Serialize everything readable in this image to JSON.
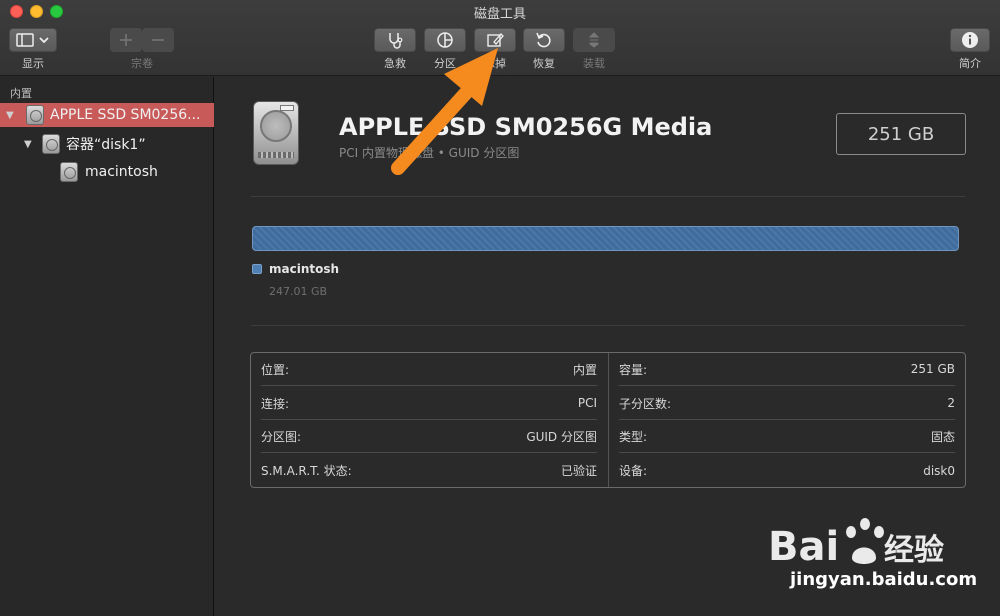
{
  "window": {
    "title": "磁盘工具"
  },
  "toolbar": {
    "view_label": "显示",
    "volume_label": "宗卷",
    "first_aid_label": "急救",
    "partition_label": "分区",
    "erase_label": "抹掉",
    "restore_label": "恢复",
    "mount_label": "装载",
    "info_label": "简介"
  },
  "sidebar": {
    "section": "内置",
    "items": [
      {
        "label": "APPLE SSD SM0256...",
        "selected": true
      },
      {
        "label": "容器“disk1”",
        "selected": false
      },
      {
        "label": "macintosh",
        "selected": false
      }
    ]
  },
  "disk": {
    "title": "APPLE SSD SM0256G Media",
    "subtitle": "PCI 内置物理磁盘 • GUID 分区图",
    "capacity": "251 GB"
  },
  "partition": {
    "name": "macintosh",
    "size": "247.01 GB",
    "fill_fraction": 1.0,
    "color": "#3f6c9e"
  },
  "info_left": [
    {
      "label": "位置:",
      "value": "内置"
    },
    {
      "label": "连接:",
      "value": "PCI"
    },
    {
      "label": "分区图:",
      "value": "GUID 分区图"
    },
    {
      "label": "S.M.A.R.T. 状态:",
      "value": "已验证"
    }
  ],
  "info_right": [
    {
      "label": "容量:",
      "value": "251 GB"
    },
    {
      "label": "子分区数:",
      "value": "2"
    },
    {
      "label": "类型:",
      "value": "固态"
    },
    {
      "label": "设备:",
      "value": "disk0"
    }
  ],
  "watermark": {
    "brand": "Bai du 经验",
    "url": "jingyan.baidu.com"
  },
  "colors": {
    "selection": "#c85a5a",
    "arrow": "#f58a1f"
  }
}
